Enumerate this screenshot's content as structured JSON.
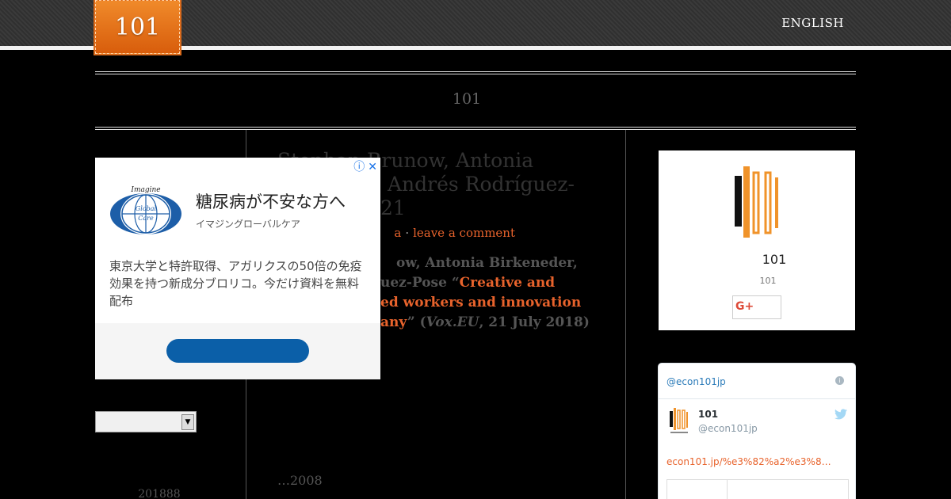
{
  "header": {
    "logo_text": "101",
    "language_link": "ENGLISH",
    "site_title": "101"
  },
  "post": {
    "title": "Stephan Brunow, Antonia Birkeneder, Andrés Rodríguez-Pose 2021",
    "title_line1": "Stephan Brunow, Antonia",
    "title_line2": "Birkeneder, Andrés Rodríguez-",
    "title_line3": "Pose 2021",
    "visible_title_line1": "Stephan Brunow, Antonia",
    "visible_title_line2": "r, Andrés Rodríguez-",
    "visible_title_line3": "21",
    "meta_author_fragment": "a",
    "meta_comment": "leave a comment",
    "excerpt_line1_prefix": "ow, Antonia Birkeneder,",
    "excerpt_line2_prefix": "uez-Pose “",
    "excerpt_line2_link": "Creative and",
    "excerpt_line3_link": "ed workers and innovation",
    "excerpt_line4_link": "any",
    "excerpt_line4_suffix_open": "” (",
    "excerpt_line4_source": "Vox.EU",
    "excerpt_line4_suffix_close": ", 21 July 2018)",
    "date_fragment": "…2008"
  },
  "left_sidebar": {
    "select_value": "",
    "archive_text": "201888"
  },
  "ad": {
    "logo_line_top": "Imagine",
    "logo_line_mid": "Global",
    "logo_line_bottom": "Care",
    "title": "糖尿病が不安な方へ",
    "advertiser": "イマジングローバルケア",
    "body": "東京大学と特許取得、アガリクスの50倍の免疫効果を持つ新成分ブロリコ。今だけ資料を無料配布",
    "info_icon": "ⓘ",
    "close_icon": "✕",
    "button_label": ""
  },
  "profile_card": {
    "name": "101",
    "subtitle": "101",
    "gplus_label": "G+"
  },
  "twitter": {
    "handle_top": "@econ101jp",
    "name": "101",
    "handle": "@econ101jp",
    "link": "econ101.jp/%e3%82%a2%e3%8…",
    "info_icon": "i"
  },
  "colors": {
    "accent": "#e8632c",
    "logo_orange": "#e5701c",
    "ad_button": "#0b5fa8",
    "twitter_blue": "#1da1f2"
  }
}
